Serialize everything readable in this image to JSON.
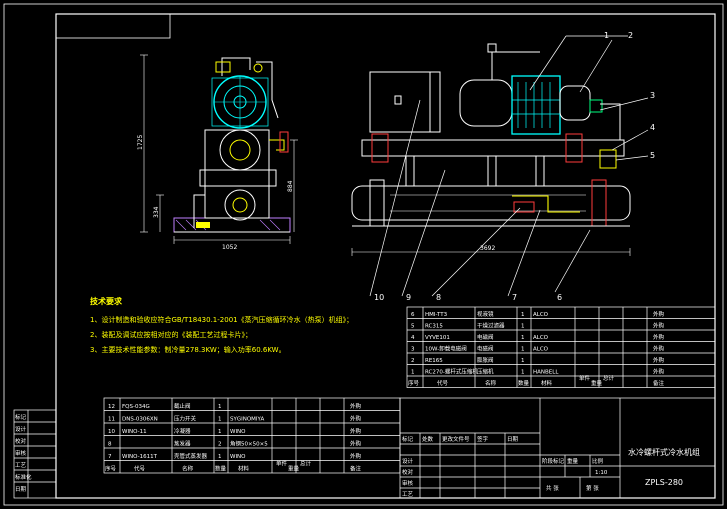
{
  "colors": {
    "background": "#000000",
    "frame": "#ffffff",
    "machine": "#e6e6e6",
    "accent": "#00ffff",
    "highlight": "#ffff00",
    "leader": "#ff3c3c",
    "hatch": "#c080ff",
    "note_text": "#ffff00"
  },
  "dimensions": {
    "height_total": "1725",
    "height_mid": "884",
    "height_base": "334",
    "width_side": "1052",
    "length_front": "3692"
  },
  "callouts": [
    "1",
    "2",
    "3",
    "4",
    "5",
    "6",
    "7",
    "8",
    "9",
    "10"
  ],
  "notes": {
    "heading": "技术要求",
    "lines": [
      "1、设计制造和验收应符合GB/T18430.1-2001《蒸汽压缩循环冷水（热泵）机组》；",
      "2、装配及调试应按相对应的《装配工艺过程卡片》；",
      "3、主要技术性能参数：制冷量278.3KW；输入功率60.6KW。"
    ]
  },
  "parts_upper": [
    {
      "no": "6",
      "code": "HMI-TT3",
      "name": "视液镜",
      "qty": "1",
      "material": "ALCO",
      "remark": "外购"
    },
    {
      "no": "5",
      "code": "RC315",
      "name": "干燥过滤器",
      "qty": "1",
      "material": "",
      "remark": "外购"
    },
    {
      "no": "4",
      "code": "VYVE101",
      "name": "电磁阀",
      "qty": "1",
      "material": "ALCO",
      "remark": "外购"
    },
    {
      "no": "3",
      "code": "10W-卸载电磁阀",
      "name": "电磁阀",
      "qty": "1",
      "material": "ALCO",
      "remark": "外购"
    },
    {
      "no": "2",
      "code": "RE165",
      "name": "膨胀阀",
      "qty": "1",
      "material": "",
      "remark": "外购"
    },
    {
      "no": "1",
      "code": "RC270-螺杆式压缩机",
      "name": "压缩机",
      "qty": "1",
      "material": "HANBELL",
      "remark": "外购"
    }
  ],
  "parts_upper_header": {
    "no": "序号",
    "code": "代号",
    "name": "名称",
    "qty": "数量",
    "material": "材料",
    "unit": "单件",
    "total": "总计",
    "weight": "重量",
    "remark": "备注"
  },
  "parts_lower": [
    {
      "no": "12",
      "code": "FQS-034G",
      "name": "截止阀",
      "qty": "1",
      "material": "",
      "remark": "外购"
    },
    {
      "no": "11",
      "code": "DNS-0306XN",
      "name": "压力开关",
      "qty": "1",
      "material": "SYGINOMIYA",
      "remark": "外购"
    },
    {
      "no": "10",
      "code": "WINO-11",
      "name": "冷凝器",
      "qty": "1",
      "material": "WINO",
      "remark": "外购"
    },
    {
      "no": "8",
      "code": "",
      "name": "蒸发器",
      "qty": "2",
      "material": "角钢50×50×5",
      "remark": "外购"
    },
    {
      "no": "7",
      "code": "WINO-1611T",
      "name": "壳管式蒸发器",
      "qty": "1",
      "material": "WINO",
      "remark": "外购"
    }
  ],
  "parts_lower_header": {
    "no": "序号",
    "code": "代号",
    "name": "名称",
    "qty": "数量",
    "material": "材料",
    "unit": "单件",
    "total": "总计",
    "weight": "重量",
    "remark": "备注"
  },
  "left_strip": [
    "标记",
    "设计",
    "校对",
    "审核",
    "工艺",
    "标准化",
    "日期"
  ],
  "title_block": {
    "product_name": "水冷螺杆式冷水机组",
    "drawing_no": "ZPLS-280",
    "rev_headers": [
      "标记",
      "处数",
      "更改文件号",
      "签字",
      "日期"
    ],
    "roles": [
      "设计",
      "校对",
      "审核",
      "工艺"
    ],
    "stage_headers": [
      "阶段标记",
      "重量",
      "比例"
    ],
    "scale": "1:10",
    "sheet": [
      "共 张",
      "第 张"
    ]
  }
}
